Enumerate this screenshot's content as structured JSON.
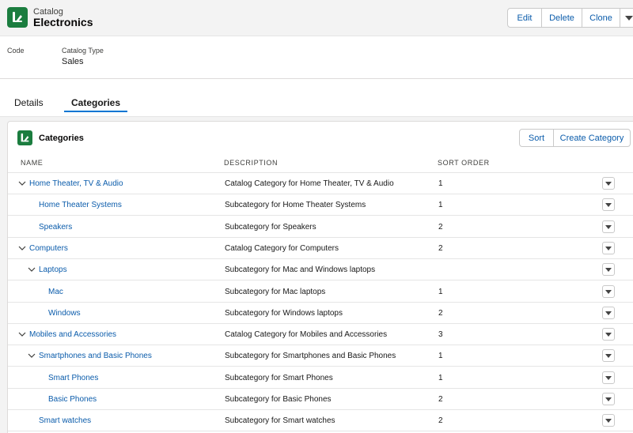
{
  "header": {
    "object_label": "Catalog",
    "record_name": "Electronics",
    "actions": {
      "edit": "Edit",
      "delete": "Delete",
      "clone": "Clone"
    },
    "fields": [
      {
        "label": "Code",
        "value": ""
      },
      {
        "label": "Catalog Type",
        "value": "Sales"
      }
    ]
  },
  "tabs": [
    {
      "label": "Details",
      "active": false
    },
    {
      "label": "Categories",
      "active": true
    }
  ],
  "related_list": {
    "title": "Categories",
    "actions": {
      "sort": "Sort",
      "create": "Create Category"
    },
    "columns": {
      "name": "NAME",
      "description": "DESCRIPTION",
      "sort_order": "SORT ORDER"
    },
    "rows": [
      {
        "name": "Home Theater, TV & Audio",
        "description": "Catalog Category for Home Theater, TV & Audio",
        "sort_order": "1",
        "level": 0,
        "expandable": true
      },
      {
        "name": "Home Theater Systems",
        "description": "Subcategory for Home Theater Systems",
        "sort_order": "1",
        "level": 1,
        "expandable": false
      },
      {
        "name": "Speakers",
        "description": "Subcategory for Speakers",
        "sort_order": "2",
        "level": 1,
        "expandable": false
      },
      {
        "name": "Computers",
        "description": "Catalog Category for Computers",
        "sort_order": "2",
        "level": 0,
        "expandable": true
      },
      {
        "name": "Laptops",
        "description": "Subcategory for Mac and Windows laptops",
        "sort_order": "",
        "level": 1,
        "expandable": true
      },
      {
        "name": "Mac",
        "description": "Subcategory for Mac laptops",
        "sort_order": "1",
        "level": 2,
        "expandable": false
      },
      {
        "name": "Windows",
        "description": "Subcategory for Windows laptops",
        "sort_order": "2",
        "level": 2,
        "expandable": false
      },
      {
        "name": "Mobiles and Accessories",
        "description": "Catalog Category for Mobiles and Accessories",
        "sort_order": "3",
        "level": 0,
        "expandable": true
      },
      {
        "name": "Smartphones and Basic Phones",
        "description": "Subcategory for Smartphones and Basic Phones",
        "sort_order": "1",
        "level": 1,
        "expandable": true
      },
      {
        "name": "Smart Phones",
        "description": "Subcategory for Smart Phones",
        "sort_order": "1",
        "level": 2,
        "expandable": false
      },
      {
        "name": "Basic Phones",
        "description": "Subcategory for Basic Phones",
        "sort_order": "2",
        "level": 2,
        "expandable": false
      },
      {
        "name": "Smart watches",
        "description": "Subcategory for Smart watches",
        "sort_order": "2",
        "level": 1,
        "expandable": false
      }
    ]
  },
  "colors": {
    "brand_icon": "#1b7d3f",
    "link": "#0b5cab",
    "tab_active": "#0176d3"
  },
  "icons": {
    "object": "catalog-icon",
    "row_menu": "chevron-down-icon",
    "tree_toggle": "chevron-down-icon"
  }
}
